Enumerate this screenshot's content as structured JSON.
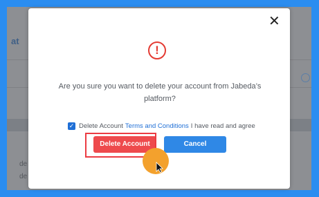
{
  "background": {
    "partial_heading": "at",
    "partial_lines": [
      "de",
      "de"
    ]
  },
  "modal": {
    "close_glyph": "✕",
    "alert_glyph": "!",
    "question": "Are you sure you want to delete your account from Jabeda’s platform?",
    "agree": {
      "checked": true,
      "prefix": "Delete Account",
      "link": "Terms and Conditions",
      "suffix": "I have read and agree"
    },
    "delete_label": "Delete Account",
    "cancel_label": "Cancel"
  },
  "colors": {
    "frame": "#2b8df0",
    "danger": "#ee4a4d",
    "primary": "#2f88e6",
    "cursor_highlight": "#f3a12d"
  }
}
